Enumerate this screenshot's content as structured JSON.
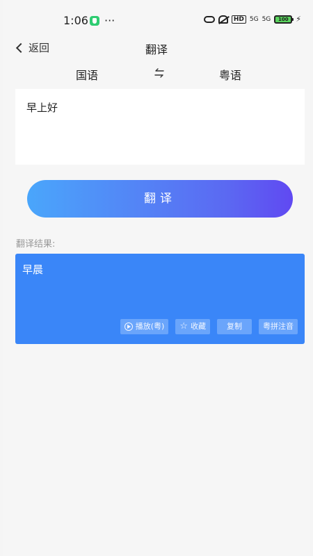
{
  "status_bar": {
    "time": "1:06",
    "more": "···",
    "hd": "HD",
    "sig1": "5G",
    "sig2": "5G",
    "battery": "100",
    "charging": "⚡"
  },
  "nav": {
    "back_label": "返回",
    "title": "翻译"
  },
  "languages": {
    "source": "国语",
    "target": "粤语",
    "swap_icon": "swap-arrows"
  },
  "input": {
    "text": "早上好"
  },
  "translate_button": {
    "label": "翻译"
  },
  "result": {
    "label": "翻译结果:",
    "text": "早晨",
    "actions": {
      "play": "播放(粤)",
      "favorite": "收藏",
      "copy": "复制",
      "pinyin": "粤拼注音"
    }
  },
  "colors": {
    "result_bg": "#3a86f8",
    "button_gradient_start": "#4aa6fb",
    "button_gradient_end": "#6049f2",
    "page_bg": "#f6f6f6"
  }
}
